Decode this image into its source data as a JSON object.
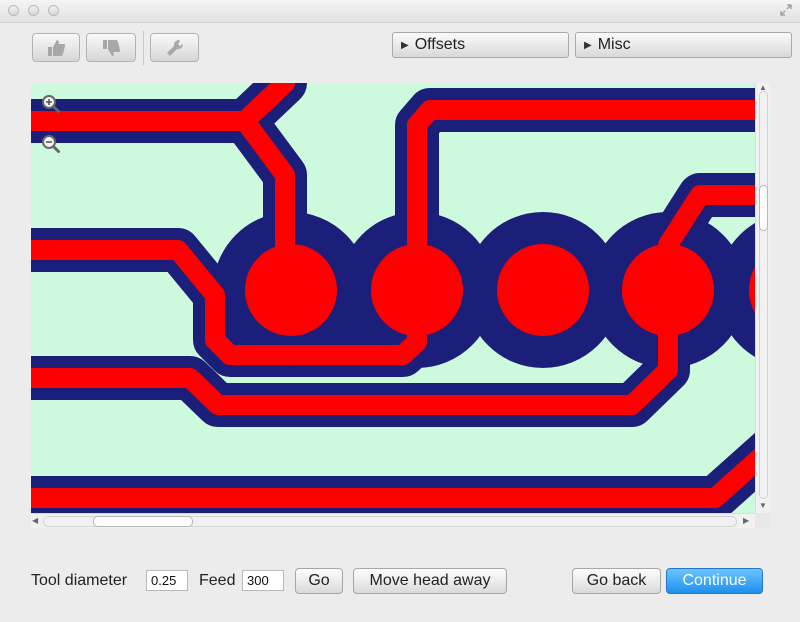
{
  "window": {
    "controls": [
      "close",
      "minimize",
      "zoom"
    ]
  },
  "toolbar": {
    "buttons": [
      {
        "icon": "thumbs-up-icon"
      },
      {
        "icon": "thumbs-down-icon"
      },
      {
        "icon": "wrench-icon"
      }
    ],
    "dropdowns": [
      {
        "label": "Offsets"
      },
      {
        "label": "Misc"
      }
    ]
  },
  "canvas": {
    "background_color": "#cdfadc",
    "trace_color": "#ff0000",
    "outline_color": "#1b1f7a",
    "zoom_in_icon": "zoom-in-icon",
    "zoom_out_icon": "zoom-out-icon"
  },
  "form": {
    "tool_diameter_label": "Tool diameter",
    "tool_diameter_value": "0.25",
    "feed_label": "Feed",
    "feed_value": "300",
    "go_label": "Go",
    "move_head_label": "Move head away",
    "go_back_label": "Go back",
    "continue_label": "Continue"
  },
  "colors": {
    "accent": "#1d8ff0"
  }
}
